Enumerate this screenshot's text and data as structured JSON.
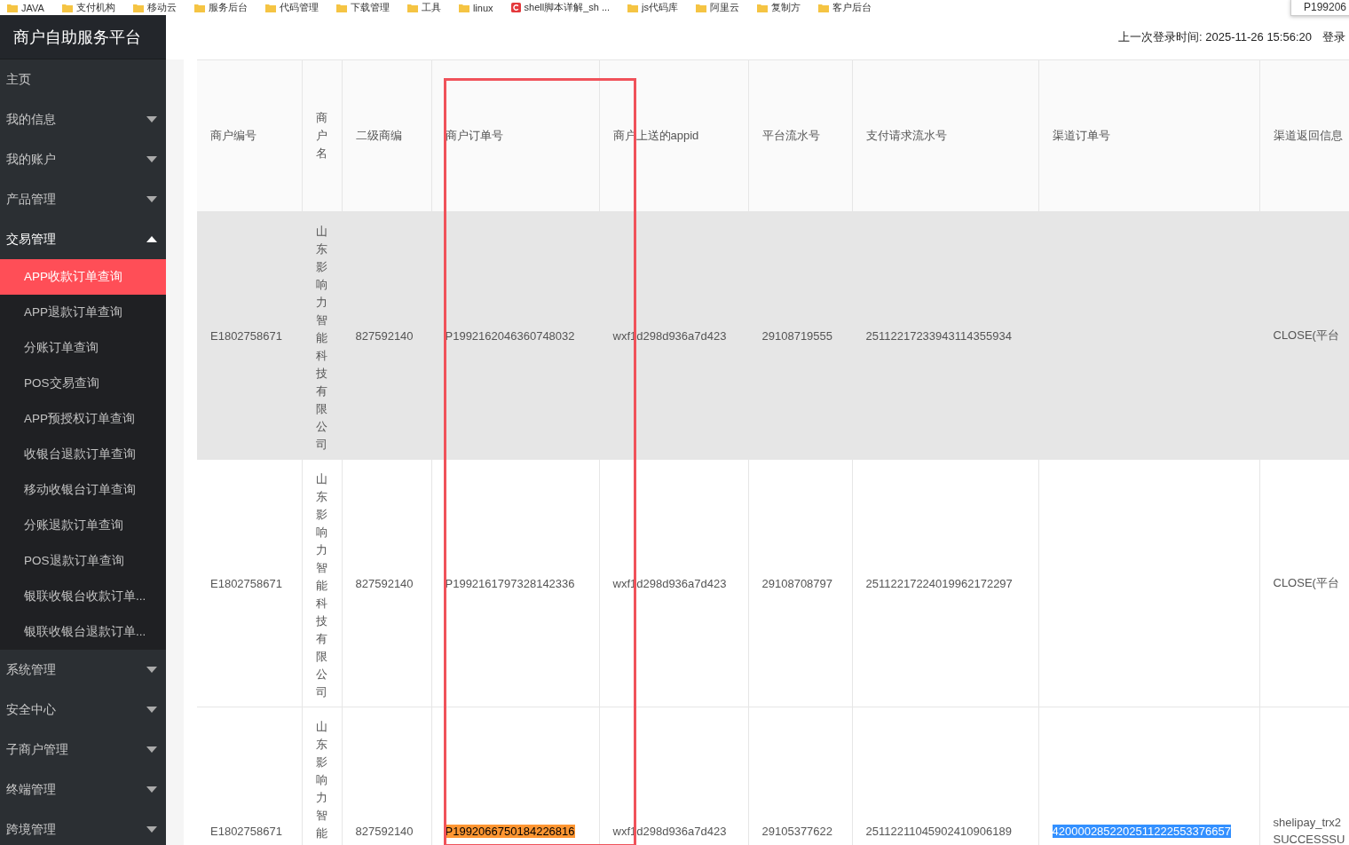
{
  "bookmarks": [
    {
      "label": "JAVA",
      "kind": "folder"
    },
    {
      "label": "支付机构",
      "kind": "folder"
    },
    {
      "label": "移动云",
      "kind": "folder"
    },
    {
      "label": "服务后台",
      "kind": "folder"
    },
    {
      "label": "代码管理",
      "kind": "folder"
    },
    {
      "label": "下载管理",
      "kind": "folder"
    },
    {
      "label": "工具",
      "kind": "folder"
    },
    {
      "label": "linux",
      "kind": "folder"
    },
    {
      "label": "shell脚本详解_sh ...",
      "kind": "site"
    },
    {
      "label": "js代码库",
      "kind": "folder"
    },
    {
      "label": "阿里云",
      "kind": "folder"
    },
    {
      "label": "复制方",
      "kind": "folder"
    },
    {
      "label": "客户后台",
      "kind": "folder"
    }
  ],
  "tooltip": {
    "text": "P199206"
  },
  "sidebar": {
    "title": "商户自助服务平台",
    "items": [
      {
        "label": "主页",
        "kind": "link"
      },
      {
        "label": "我的信息",
        "kind": "group",
        "expanded": false
      },
      {
        "label": "我的账户",
        "kind": "group",
        "expanded": false
      },
      {
        "label": "产品管理",
        "kind": "group",
        "expanded": false
      },
      {
        "label": "交易管理",
        "kind": "group",
        "expanded": true,
        "children": [
          {
            "label": "APP收款订单查询",
            "selected": true
          },
          {
            "label": "APP退款订单查询",
            "selected": false
          },
          {
            "label": "分账订单查询",
            "selected": false
          },
          {
            "label": "POS交易查询",
            "selected": false
          },
          {
            "label": "APP预授权订单查询",
            "selected": false
          },
          {
            "label": "收银台退款订单查询",
            "selected": false
          },
          {
            "label": "移动收银台订单查询",
            "selected": false
          },
          {
            "label": "分账退款订单查询",
            "selected": false
          },
          {
            "label": "POS退款订单查询",
            "selected": false
          },
          {
            "label": "银联收银台收款订单...",
            "selected": false
          },
          {
            "label": "银联收银台退款订单...",
            "selected": false
          }
        ]
      },
      {
        "label": "系统管理",
        "kind": "group",
        "expanded": false
      },
      {
        "label": "安全中心",
        "kind": "group",
        "expanded": false
      },
      {
        "label": "子商户管理",
        "kind": "group",
        "expanded": false
      },
      {
        "label": "终端管理",
        "kind": "group",
        "expanded": false
      },
      {
        "label": "跨境管理",
        "kind": "group",
        "expanded": false
      }
    ]
  },
  "header": {
    "last_login": "上一次登录时间: 2025-11-26 15:56:20",
    "login_link": "登录"
  },
  "table": {
    "columns": [
      {
        "label": "商户编号",
        "kind": "text"
      },
      {
        "label": "商户名",
        "kind": "vertical"
      },
      {
        "label": "二级商编",
        "kind": "text"
      },
      {
        "label": "商户订单号",
        "kind": "text"
      },
      {
        "label": "商户上送的appid",
        "kind": "text"
      },
      {
        "label": "平台流水号",
        "kind": "text"
      },
      {
        "label": "支付请求流水号",
        "kind": "text"
      },
      {
        "label": "渠道订单号",
        "kind": "text"
      },
      {
        "label": "渠道返回信息",
        "kind": "text"
      }
    ],
    "rows": [
      {
        "selected": true,
        "cells": [
          {
            "text": "E1802758671"
          },
          {
            "text": "山东影响力智能科技有限公司"
          },
          {
            "text": "827592140"
          },
          {
            "text": "P1992162046360748032"
          },
          {
            "text": "wxf1d298d936a7d423"
          },
          {
            "text": "29108719555"
          },
          {
            "text": "25112217233943114355934"
          },
          {},
          {
            "text": "CLOSE(平台"
          }
        ]
      },
      {
        "selected": false,
        "cells": [
          {
            "text": "E1802758671"
          },
          {
            "text": "山东影响力智能科技有限公司"
          },
          {
            "text": "827592140"
          },
          {
            "text": "P1992161797328142336"
          },
          {
            "text": "wxf1d298d936a7d423"
          },
          {
            "text": "29108708797"
          },
          {
            "text": "25112217224019962172297"
          },
          {},
          {
            "text": "CLOSE(平台"
          }
        ]
      },
      {
        "selected": false,
        "cells": [
          {
            "text": "E1802758671"
          },
          {
            "text": "山东影响力智能"
          },
          {
            "text": "827592140"
          },
          {
            "text": "P1992066750184226816",
            "kind": "match"
          },
          {
            "text": "wxf1d298d936a7d423"
          },
          {
            "text": "29105377622"
          },
          {
            "text": "25112211045902410906189"
          },
          {
            "text": "4200002852202511222553376657",
            "kind": "selection"
          },
          {
            "lines": [
              "shelipay_trx2",
              "SUCCESSSU"
            ]
          }
        ]
      }
    ]
  },
  "annotation": {
    "kind": "frame"
  }
}
